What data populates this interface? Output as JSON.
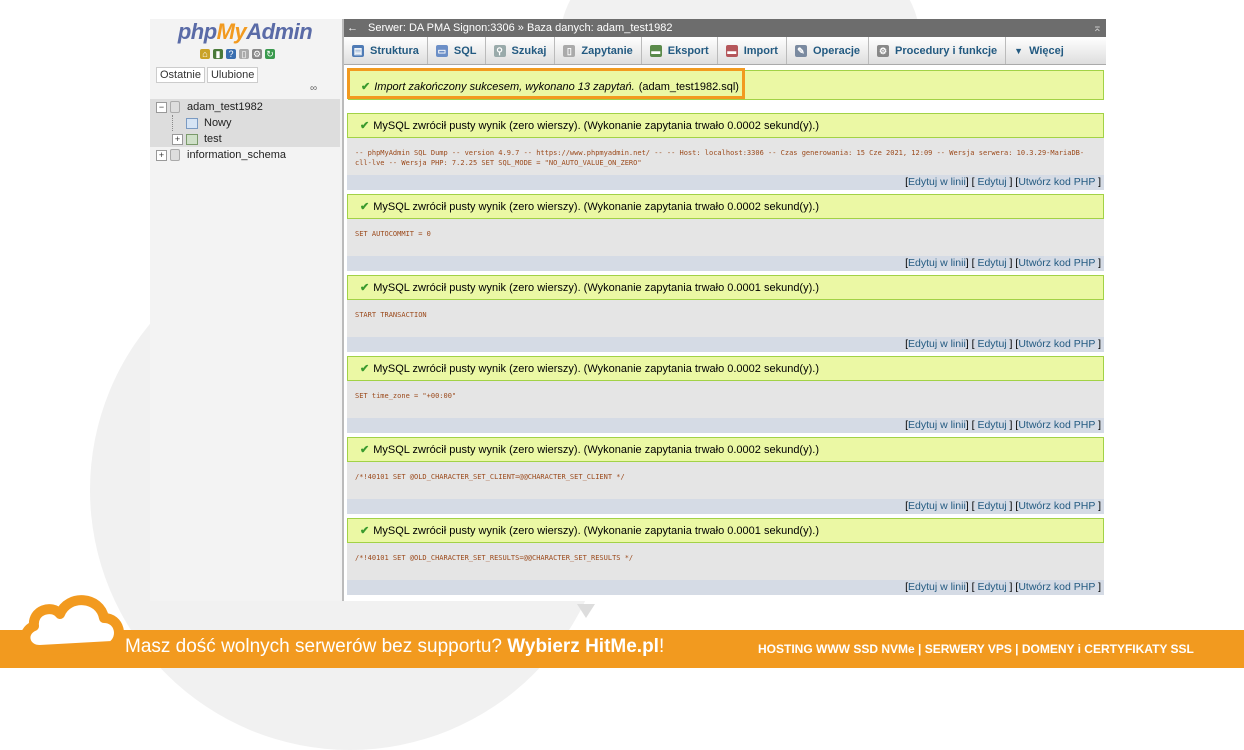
{
  "sidebar": {
    "logo_php": "php",
    "logo_my": "My",
    "logo_admin": "Admin",
    "tabs": [
      "Ostatnie",
      "Ulubione"
    ],
    "tree": {
      "db1": "adam_test1982",
      "db1_new": "Nowy",
      "db1_table": "test",
      "db2": "information_schema"
    }
  },
  "topbar": {
    "back": "←",
    "breadcrumb": "Serwer: DA PMA Signon:3306 » Baza danych: adam_test1982",
    "collapse": "⌅"
  },
  "tabs": [
    "Struktura",
    "SQL",
    "Szukaj",
    "Zapytanie",
    "Eksport",
    "Import",
    "Operacje",
    "Procedury i funkcje",
    "Więcej"
  ],
  "import_message": "Import zakończony sukcesem, wykonano 13 zapytań.",
  "import_file": "(adam_test1982.sql)",
  "results": [
    {
      "message": "MySQL zwrócił pusty wynik (zero wierszy). (Wykonanie zapytania trwało 0.0002 sekund(y).)",
      "sql": "-- phpMyAdmin SQL Dump -- version 4.9.7 -- https://www.phpmyadmin.net/ -- -- Host: localhost:3306 -- Czas generowania: 15 Cze 2021, 12:09 -- Wersja serwera: 10.3.29-MariaDB-cll-lve -- Wersja PHP: 7.2.25 SET SQL_MODE = \"NO_AUTO_VALUE_ON_ZERO\""
    },
    {
      "message": "MySQL zwrócił pusty wynik (zero wierszy). (Wykonanie zapytania trwało 0.0002 sekund(y).)",
      "sql": "SET AUTOCOMMIT = 0"
    },
    {
      "message": "MySQL zwrócił pusty wynik (zero wierszy). (Wykonanie zapytania trwało 0.0001 sekund(y).)",
      "sql": "START TRANSACTION"
    },
    {
      "message": "MySQL zwrócił pusty wynik (zero wierszy). (Wykonanie zapytania trwało 0.0002 sekund(y).)",
      "sql": "SET time_zone = \"+00:00\""
    },
    {
      "message": "MySQL zwrócił pusty wynik (zero wierszy). (Wykonanie zapytania trwało 0.0002 sekund(y).)",
      "sql": "/*!40101 SET @OLD_CHARACTER_SET_CLIENT=@@CHARACTER_SET_CLIENT */"
    },
    {
      "message": "MySQL zwrócił pusty wynik (zero wierszy). (Wykonanie zapytania trwało 0.0001 sekund(y).)",
      "sql": "/*!40101 SET @OLD_CHARACTER_SET_RESULTS=@@CHARACTER_SET_RESULTS */"
    }
  ],
  "result_links": {
    "edit_inline": "Edytuj w linii",
    "edit": "Edytuj",
    "php": "Utwórz kod PHP"
  },
  "footer": {
    "text_light": "Masz dość wolnych serwerów bez supportu?",
    "text_bold": "Wybierz HitMe.pl",
    "text_end": "!",
    "right": "HOSTING WWW SSD NVMe | SERWERY VPS | DOMENY i CERTYFIKATY SSL"
  },
  "colors": {
    "success_bg": "#ebf8a4",
    "highlight": "#f29a1f",
    "link": "#235a81"
  }
}
